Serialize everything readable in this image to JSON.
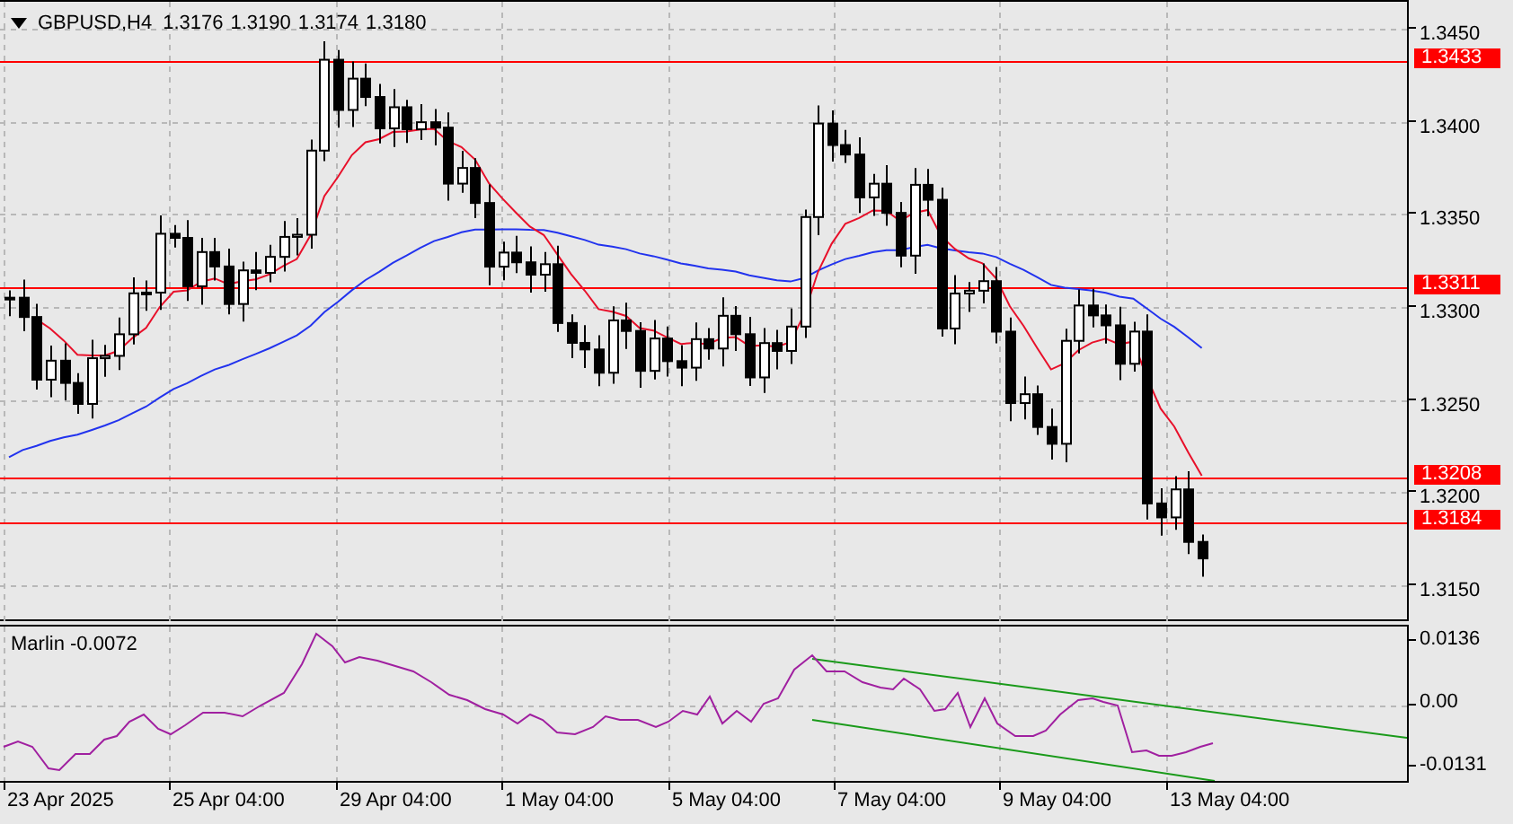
{
  "chart_header": {
    "symbol": "GBPUSD,H4",
    "ohlc": [
      "1.3176",
      "1.3190",
      "1.3174",
      "1.3180"
    ]
  },
  "price_axis": {
    "ticks": [
      "1.3450",
      "1.3400",
      "1.3350",
      "1.3300",
      "1.3250",
      "1.3200",
      "1.3150"
    ]
  },
  "levels": [
    {
      "price": "1.3433"
    },
    {
      "price": "1.3311"
    },
    {
      "price": "1.3208"
    },
    {
      "price": "1.3184"
    }
  ],
  "indicator": {
    "label": "Marlin -0.0072",
    "ticks": [
      "0.0136",
      "0.00",
      "-0.0131"
    ]
  },
  "time_axis": {
    "labels": [
      "23 Apr 2025",
      "25 Apr 04:00",
      "29 Apr 04:00",
      "1 May 04:00",
      "5 May 04:00",
      "7 May 04:00",
      "9 May 04:00",
      "13 May 04:00"
    ]
  }
}
